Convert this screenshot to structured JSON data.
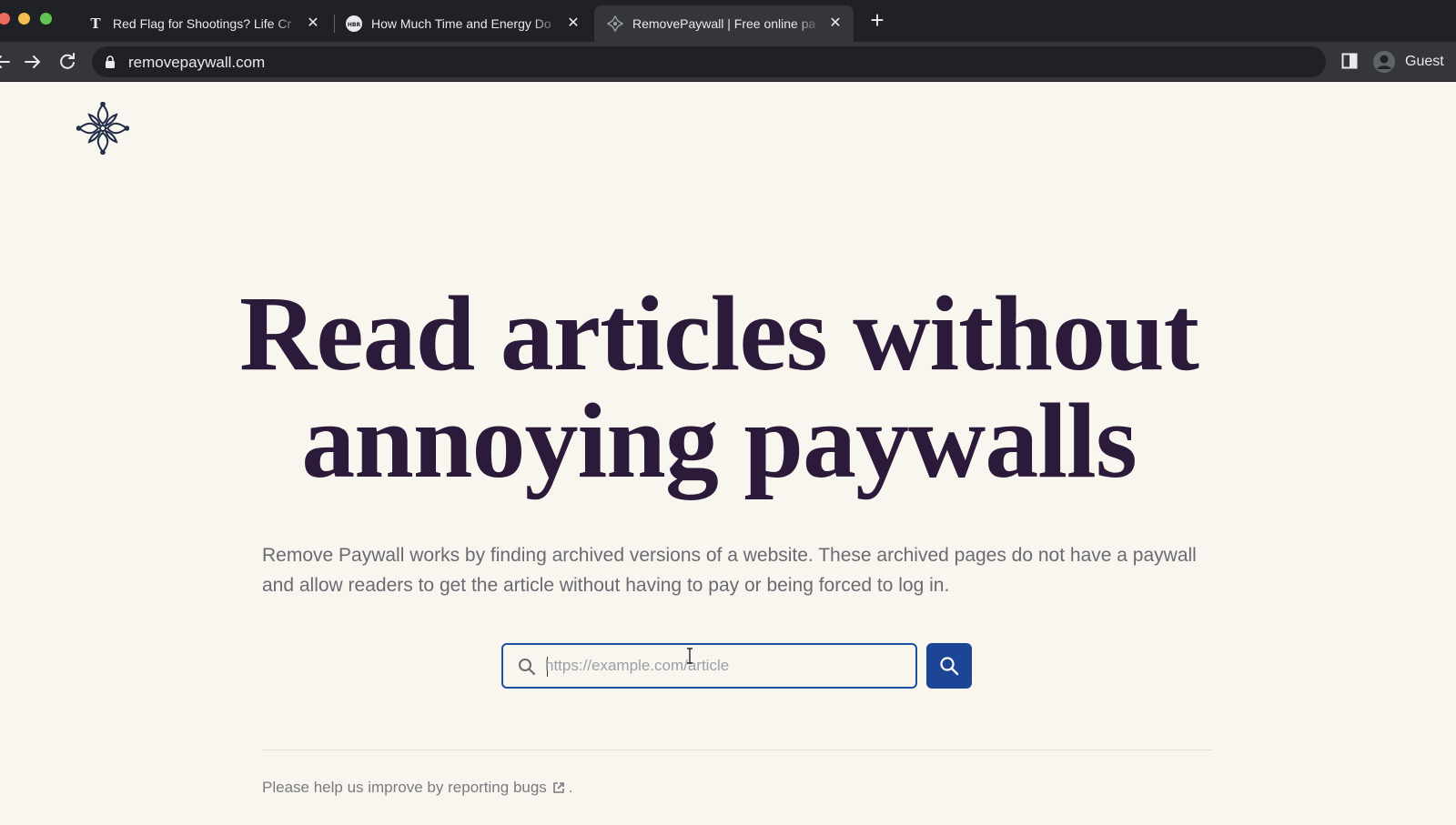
{
  "browser": {
    "tabs": [
      {
        "title": "Red Flag for Shootings? Life Cr",
        "favicon": "nyt-icon",
        "active": false
      },
      {
        "title": "How Much Time and Energy Do",
        "favicon": "hbr-icon",
        "active": false
      },
      {
        "title": "RemovePaywall | Free online pa",
        "favicon": "removepaywall-icon",
        "active": true
      }
    ],
    "hbr_favicon_text": "HBR",
    "nyt_favicon_text": "T",
    "close_glyph": "✕",
    "new_tab_glyph": "+",
    "url": "removepaywall.com",
    "profile_label": "Guest"
  },
  "page": {
    "headline_line1": "Read articles without",
    "headline_line2": "annoying paywalls",
    "description": "Remove Paywall works by finding archived versions of a website. These archived pages do not have a paywall and allow readers to get the article without having to pay or being forced to log in.",
    "search": {
      "placeholder": "https://example.com/article",
      "value": ""
    },
    "footer": {
      "text": "Please help us improve by",
      "link_text": "reporting bugs",
      "trailing": "."
    }
  },
  "colors": {
    "background": "#f9f6f0",
    "headline": "#2c1a3a",
    "accent": "#1d4596"
  }
}
